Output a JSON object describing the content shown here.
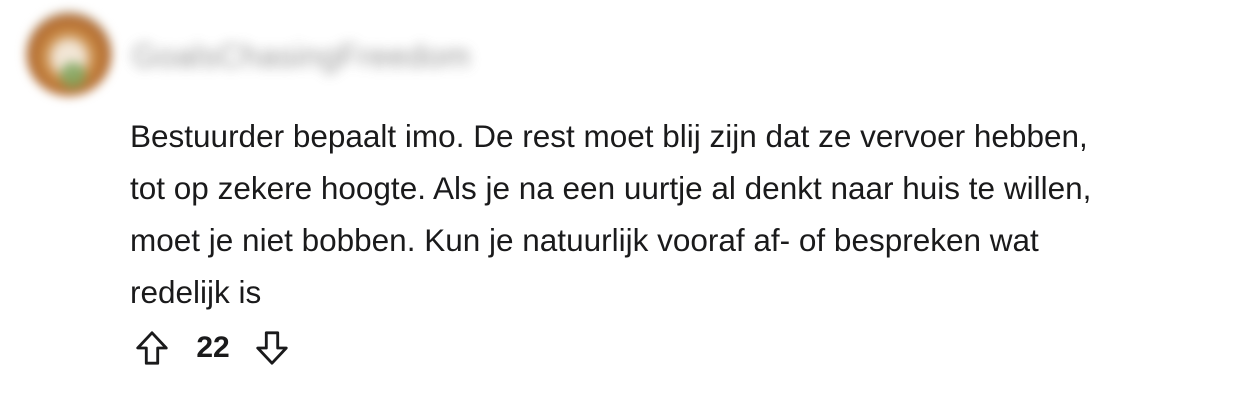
{
  "comment": {
    "author": "GoalsChasingFreedom",
    "avatar_icon": "user-avatar",
    "body_lines": [
      "Bestuurder bepaalt imo. De rest moet blij zijn dat ze vervoer hebben,",
      "tot op zekere hoogte. Als je na een uurtje al denkt naar huis te willen,",
      "moet je niet bobben. Kun je natuurlijk vooraf af- of bespreken wat",
      "redelijk is"
    ],
    "votes": {
      "upvote_icon": "arrow-up-icon",
      "score": "22",
      "downvote_icon": "arrow-down-icon"
    }
  }
}
